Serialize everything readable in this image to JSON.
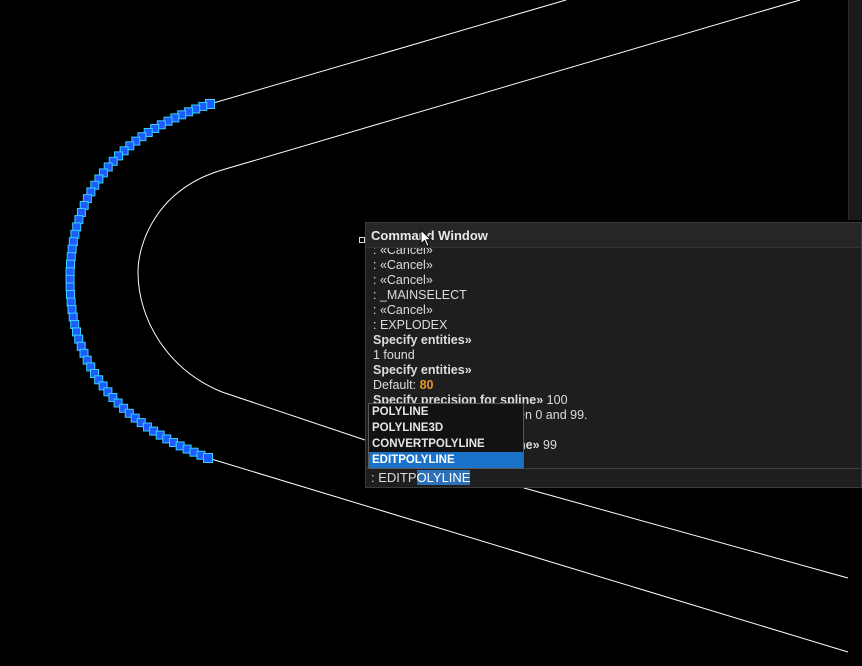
{
  "colors": {
    "background": "#000000",
    "drawing_line": "#ffffff",
    "grip_fill": "#1e5bff",
    "grip_outline": "#35d0ff",
    "highlight": "#1a73c8",
    "default_value": "#e8922b"
  },
  "command_window": {
    "title": "Command Window",
    "history": [
      {
        "prefix": ": ",
        "text": "«Cancel»"
      },
      {
        "prefix": ": ",
        "text": "«Cancel»"
      },
      {
        "prefix": ": ",
        "text": "«Cancel»"
      },
      {
        "prefix": ": ",
        "text": "_MAINSELECT"
      },
      {
        "prefix": ": ",
        "text": "«Cancel»"
      },
      {
        "prefix": ": ",
        "text": "EXPLODEX"
      },
      {
        "text": "Specify entities»"
      },
      {
        "text": "1 found"
      },
      {
        "text": "Specify entities»"
      },
      {
        "label": "Default: ",
        "value": "80"
      },
      {
        "text": "Specify precision for spline»",
        "value": " 100"
      },
      {
        "text": "en 0 and 99."
      },
      {
        "text": "ne»",
        "value": " 99"
      }
    ],
    "input": {
      "prefix": ": EDITP",
      "completion": "OLYLINE"
    }
  },
  "autocomplete": {
    "items": [
      "POLYLINE",
      "POLYLINE3D",
      "CONVERTPOLYLINE",
      "EDITPOLYLINE"
    ],
    "active_index": 3
  }
}
